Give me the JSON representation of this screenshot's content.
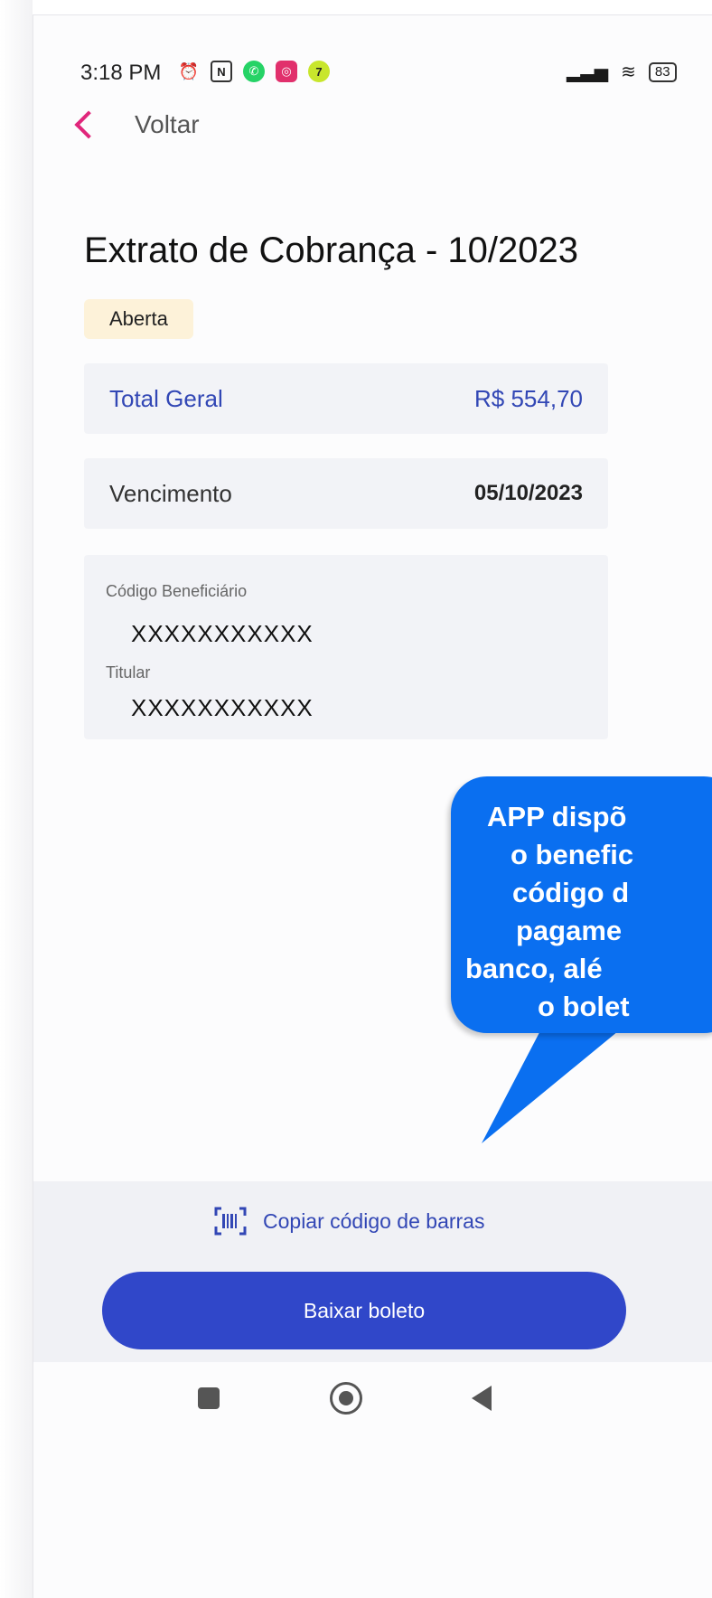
{
  "status_bar": {
    "time": "3:18 PM",
    "battery": "83"
  },
  "nav": {
    "back_label": "Voltar"
  },
  "page": {
    "title": "Extrato de Cobrança - 10/2023",
    "status_badge": "Aberta"
  },
  "summary": {
    "total_label": "Total Geral",
    "total_value": "R$ 554,70",
    "due_label": "Vencimento",
    "due_value": "05/10/2023"
  },
  "details": {
    "beneficiary_label": "Código Beneficiário",
    "beneficiary_value": "XXXXXXXXXXX",
    "holder_label": "Titular",
    "holder_value": "XXXXXXXXXXX"
  },
  "callout": {
    "lines": [
      "APP dispõ",
      "o benefic",
      "código d",
      "pagame",
      "banco, alé",
      "o bolet"
    ]
  },
  "actions": {
    "copy_barcode_label": "Copiar código de barras",
    "download_label": "Baixar boleto"
  },
  "colors": {
    "accent": "#3047c9",
    "back_chevron": "#e0267b",
    "callout": "#0a6ff0",
    "badge_bg": "#fdf2d9"
  }
}
